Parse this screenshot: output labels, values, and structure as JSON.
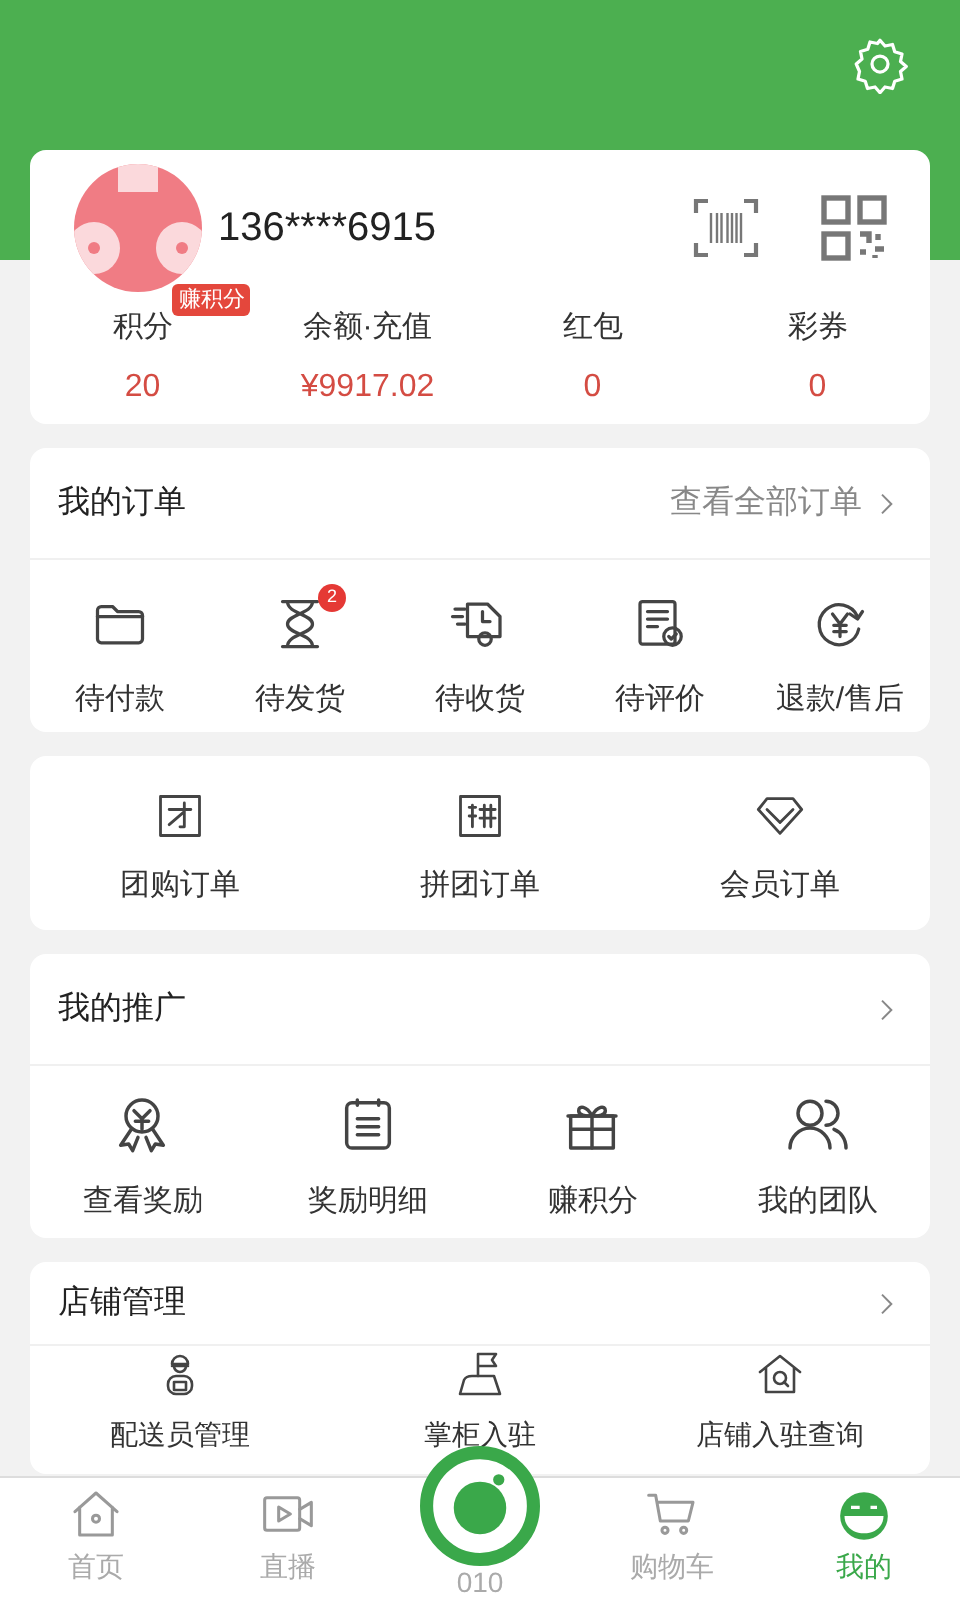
{
  "profile": {
    "phone": "136****6915",
    "stats": [
      {
        "label": "积分",
        "badge": "赚积分",
        "value": "20"
      },
      {
        "label": "余额·充值",
        "value": "¥9917.02"
      },
      {
        "label": "红包",
        "value": "0"
      },
      {
        "label": "彩券",
        "value": "0"
      }
    ]
  },
  "orders": {
    "title": "我的订单",
    "link": "查看全部订单",
    "items": [
      {
        "label": "待付款"
      },
      {
        "label": "待发货",
        "badge": "2"
      },
      {
        "label": "待收货"
      },
      {
        "label": "待评价"
      },
      {
        "label": "退款/售后"
      }
    ]
  },
  "special_orders": {
    "items": [
      {
        "label": "团购订单"
      },
      {
        "label": "拼团订单"
      },
      {
        "label": "会员订单"
      }
    ]
  },
  "promotion": {
    "title": "我的推广",
    "items": [
      {
        "label": "查看奖励"
      },
      {
        "label": "奖励明细"
      },
      {
        "label": "赚积分"
      },
      {
        "label": "我的团队"
      }
    ]
  },
  "store": {
    "title": "店铺管理",
    "items": [
      {
        "label": "配送员管理"
      },
      {
        "label": "掌柜入驻"
      },
      {
        "label": "店铺入驻查询"
      }
    ]
  },
  "tab_bar": {
    "items": [
      {
        "label": "首页",
        "selected": false
      },
      {
        "label": "直播",
        "selected": false
      },
      {
        "label": "010",
        "kind": "center",
        "selected": false
      },
      {
        "label": "购物车",
        "selected": false
      },
      {
        "label": "我的",
        "selected": true
      }
    ]
  }
}
